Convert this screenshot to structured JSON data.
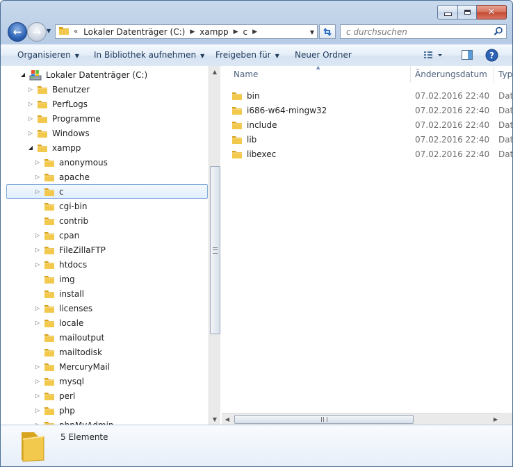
{
  "window": {
    "close_glyph": "✕"
  },
  "address": {
    "lead": "«",
    "crumbs": [
      "Lokaler Datenträger (C:)",
      "xampp",
      "c"
    ]
  },
  "search": {
    "placeholder": "c durchsuchen"
  },
  "toolbar": {
    "organize": "Organisieren",
    "library": "In Bibliothek aufnehmen",
    "share": "Freigeben für",
    "new_folder": "Neuer Ordner"
  },
  "tree": {
    "items": [
      {
        "label": "Lokaler Datenträger (C:)",
        "level": 0,
        "expander": "open",
        "icon": "drive-icon"
      },
      {
        "label": "Benutzer",
        "level": 1,
        "expander": "closed",
        "icon": "folder-icon"
      },
      {
        "label": "PerfLogs",
        "level": 1,
        "expander": "closed",
        "icon": "folder-icon"
      },
      {
        "label": "Programme",
        "level": 1,
        "expander": "closed",
        "icon": "folder-icon"
      },
      {
        "label": "Windows",
        "level": 1,
        "expander": "closed",
        "icon": "folder-icon"
      },
      {
        "label": "xampp",
        "level": 1,
        "expander": "open",
        "icon": "folder-icon"
      },
      {
        "label": "anonymous",
        "level": 2,
        "expander": "closed",
        "icon": "folder-icon"
      },
      {
        "label": "apache",
        "level": 2,
        "expander": "closed",
        "icon": "folder-icon"
      },
      {
        "label": "c",
        "level": 2,
        "expander": "closed",
        "icon": "folder-icon",
        "selected": true
      },
      {
        "label": "cgi-bin",
        "level": 2,
        "expander": "none",
        "icon": "folder-icon"
      },
      {
        "label": "contrib",
        "level": 2,
        "expander": "none",
        "icon": "folder-icon"
      },
      {
        "label": "cpan",
        "level": 2,
        "expander": "closed",
        "icon": "folder-icon"
      },
      {
        "label": "FileZillaFTP",
        "level": 2,
        "expander": "closed",
        "icon": "folder-icon"
      },
      {
        "label": "htdocs",
        "level": 2,
        "expander": "closed",
        "icon": "folder-icon"
      },
      {
        "label": "img",
        "level": 2,
        "expander": "none",
        "icon": "folder-icon"
      },
      {
        "label": "install",
        "level": 2,
        "expander": "none",
        "icon": "folder-icon"
      },
      {
        "label": "licenses",
        "level": 2,
        "expander": "closed",
        "icon": "folder-icon"
      },
      {
        "label": "locale",
        "level": 2,
        "expander": "closed",
        "icon": "folder-icon"
      },
      {
        "label": "mailoutput",
        "level": 2,
        "expander": "none",
        "icon": "folder-icon"
      },
      {
        "label": "mailtodisk",
        "level": 2,
        "expander": "none",
        "icon": "folder-icon"
      },
      {
        "label": "MercuryMail",
        "level": 2,
        "expander": "closed",
        "icon": "folder-icon"
      },
      {
        "label": "mysql",
        "level": 2,
        "expander": "closed",
        "icon": "folder-icon"
      },
      {
        "label": "perl",
        "level": 2,
        "expander": "closed",
        "icon": "folder-icon"
      },
      {
        "label": "php",
        "level": 2,
        "expander": "closed",
        "icon": "folder-icon"
      },
      {
        "label": "phpMyAdmin",
        "level": 2,
        "expander": "closed",
        "icon": "folder-icon"
      }
    ]
  },
  "list": {
    "columns": [
      "Name",
      "Änderungsdatum",
      "Typ"
    ],
    "files": [
      {
        "name": "bin",
        "date": "07.02.2016 22:40",
        "type": "Dat"
      },
      {
        "name": "i686-w64-mingw32",
        "date": "07.02.2016 22:40",
        "type": "Dat"
      },
      {
        "name": "include",
        "date": "07.02.2016 22:40",
        "type": "Dat"
      },
      {
        "name": "lib",
        "date": "07.02.2016 22:40",
        "type": "Dat"
      },
      {
        "name": "libexec",
        "date": "07.02.2016 22:40",
        "type": "Dat"
      }
    ]
  },
  "details": {
    "count": "5 Elemente"
  },
  "colors": {
    "folder": "#f2c94c",
    "folder_dark": "#d9a520",
    "accent": "#2d63b5",
    "selection_border": "#84acdd"
  }
}
